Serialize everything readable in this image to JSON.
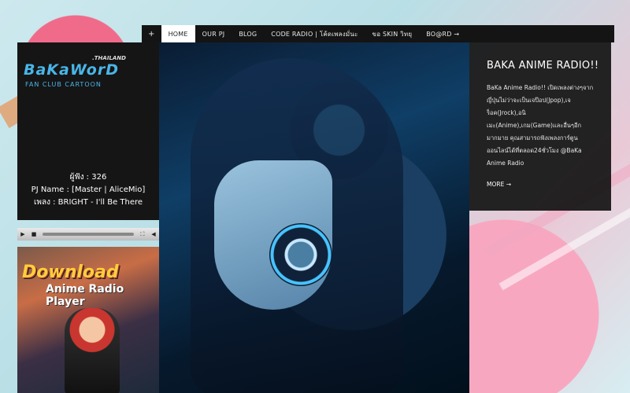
{
  "nav": {
    "plus": "+",
    "items": [
      "HOME",
      "OUR PJ",
      "BLOG",
      "CODE RADIO | โค้ดเพลงมั่นะ",
      "ขอ SKIN วิทยุ",
      "BO@RD →"
    ]
  },
  "logo": {
    "thai_label": ".THAILAND",
    "main": "BaKaWorD",
    "sub": "FAN CLUB CARTOON"
  },
  "now_playing": {
    "listeners": "ผู้ฟัง : 326",
    "pj_name": "PJ Name : [Master | AliceMio]",
    "song": "เพลง : BRIGHT - I'll Be There"
  },
  "player": {
    "play_icon": "play-icon",
    "stop_icon": "stop-icon",
    "fullscreen_icon": "fullscreen-icon",
    "mute_icon": "volume-icon"
  },
  "poster": {
    "title1": "Download",
    "title2": "Anime Radio Player"
  },
  "panel": {
    "title": "BAKA ANIME RADIO!!",
    "text": "BaKa Anime Radio!! เปิดเพลงต่างๆจากญี่ปุ่นไม่ว่าจะเป็นเจป๊อป(Jpop),เจร็อค(Jrock),อนิเมะ(Anime),เกม(Game)และอื่นๆอีกมากมาย คุณสามารถฟังเพลงการ์ตูนออนไลน์ได้ที่ตลอด24ชั่วโมง @BaKa Anime Radio",
    "more": "MORE →"
  },
  "colors": {
    "nav_bg": "#141414",
    "panel_bg": "#141414",
    "logo_blue": "#49b6e8"
  }
}
